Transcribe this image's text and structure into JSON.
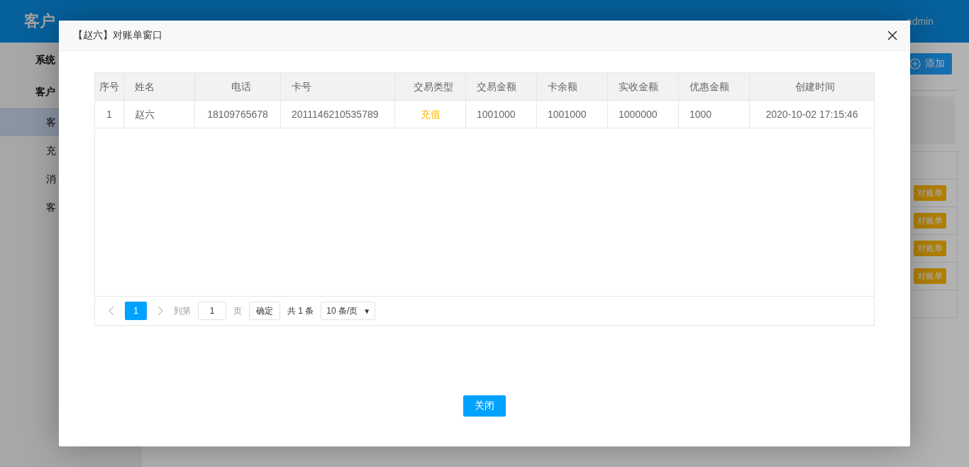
{
  "app": {
    "title": "客户",
    "user": "admin"
  },
  "sidebar": [
    {
      "label": "系统",
      "kind": "group",
      "selected": false
    },
    {
      "label": "客户",
      "kind": "group",
      "selected": false
    },
    {
      "label": "客",
      "kind": "item",
      "selected": true
    },
    {
      "label": "充",
      "kind": "item",
      "selected": false
    },
    {
      "label": "消",
      "kind": "item",
      "selected": false
    },
    {
      "label": "客",
      "kind": "item",
      "selected": false
    }
  ],
  "toolbar": {
    "add_button": "添加"
  },
  "records_table": {
    "rows": [
      {
        "action": "对账单"
      },
      {
        "action": "对账单"
      },
      {
        "action": "对账单"
      },
      {
        "action": "对账单"
      }
    ]
  },
  "dialog": {
    "title": "【赵六】对账单窗口",
    "columns": [
      "序号",
      "姓名",
      "电话",
      "卡号",
      "交易类型",
      "交易金额",
      "卡余额",
      "实收金额",
      "优惠金额",
      "创建时间"
    ],
    "rows": [
      [
        "1",
        "赵六",
        "18109765678",
        "2011146210535789",
        "充值",
        "1001000",
        "1001000",
        "1000000",
        "1000",
        "2020-10-02 17:15:46"
      ]
    ],
    "pagination": {
      "prev": {
        "disabled": true
      },
      "pages": [
        {
          "label": "1",
          "selected": true
        }
      ],
      "next": {
        "disabled": true
      },
      "goto_label": "到第",
      "goto_value": "1",
      "page_unit": "页",
      "confirm": "确定",
      "total": "共 1 条",
      "page_size": "10 条/页",
      "caret": "▼"
    },
    "close_button": "关闭"
  }
}
